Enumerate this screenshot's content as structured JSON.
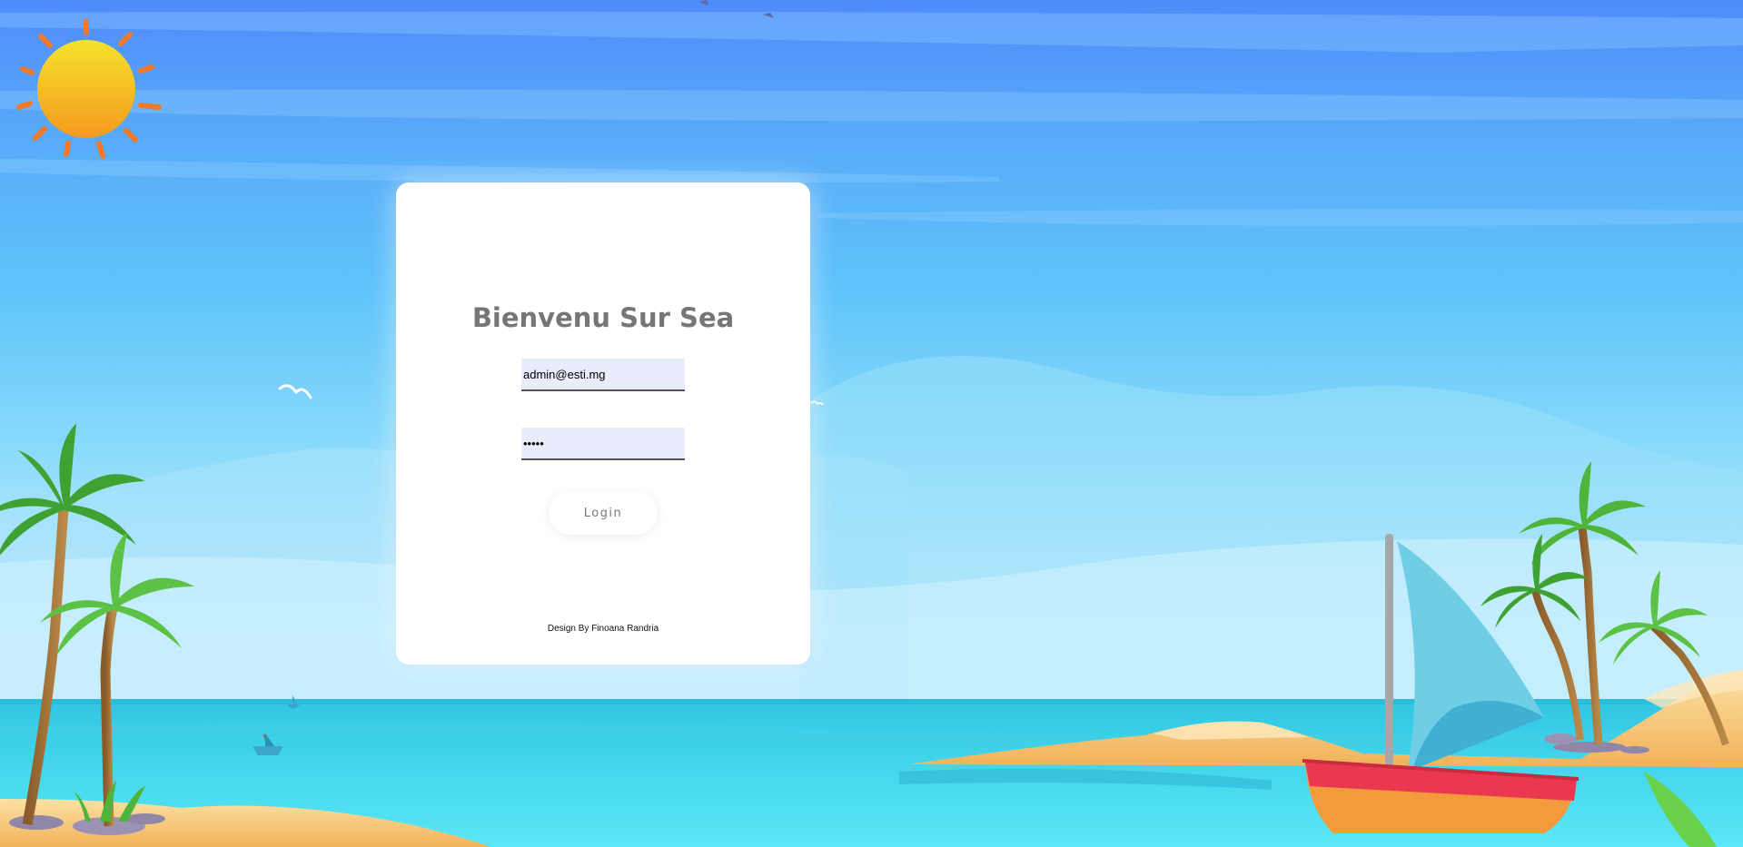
{
  "login": {
    "title": "Bienvenu Sur Sea",
    "email_value": "admin@esti.mg",
    "password_value": "•••••",
    "button_label": "Login",
    "footer": "Design By Finoana Randria"
  },
  "theme": {
    "sky_top": "#4f8bfb",
    "sea": "#3fd3ea",
    "sand": "#f6c56f",
    "sun": "#f7c824",
    "boat_hull": "#f39a3c",
    "boat_stripe": "#e9384f",
    "sail": "#6fcde6",
    "palm_leaf": "#4fb43a",
    "input_bg": "#e8ecfb",
    "title_color": "#767676"
  },
  "icons": [
    "sun-icon",
    "seagull-icon",
    "palm-tree-icon",
    "sailboat-icon",
    "island-icon"
  ]
}
